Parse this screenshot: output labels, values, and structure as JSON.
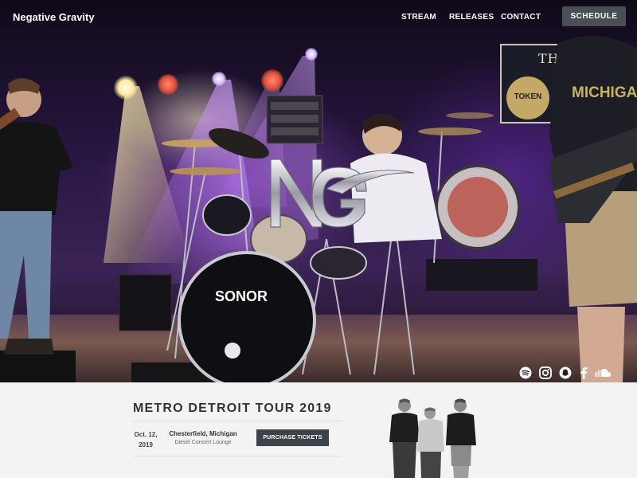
{
  "header": {
    "brand": "Negative Gravity",
    "nav": [
      {
        "label": "STREAM"
      },
      {
        "label": "RELEASES"
      },
      {
        "label": "CONTACT"
      }
    ],
    "schedule_label": "SCHEDULE"
  },
  "hero": {
    "logo_letters": "NG",
    "venue_sign_text": "THE",
    "venue_sign_badge": "TOKEN",
    "shirt_text": "MICHIGAN",
    "bass_drum_text": "SONOR"
  },
  "social": [
    {
      "icon": "spotify-icon"
    },
    {
      "icon": "instagram-icon"
    },
    {
      "icon": "snapchat-icon"
    },
    {
      "icon": "facebook-icon"
    },
    {
      "icon": "soundcloud-icon"
    }
  ],
  "tour": {
    "title": "METRO DETROIT TOUR 2019",
    "events": [
      {
        "date_line1": "Oct. 12,",
        "date_line2": "2019",
        "city": "Chesterfield, Michigan",
        "venue": "Diesel Concert Lounge",
        "button_label": "PURCHASE TICKETS"
      }
    ]
  }
}
